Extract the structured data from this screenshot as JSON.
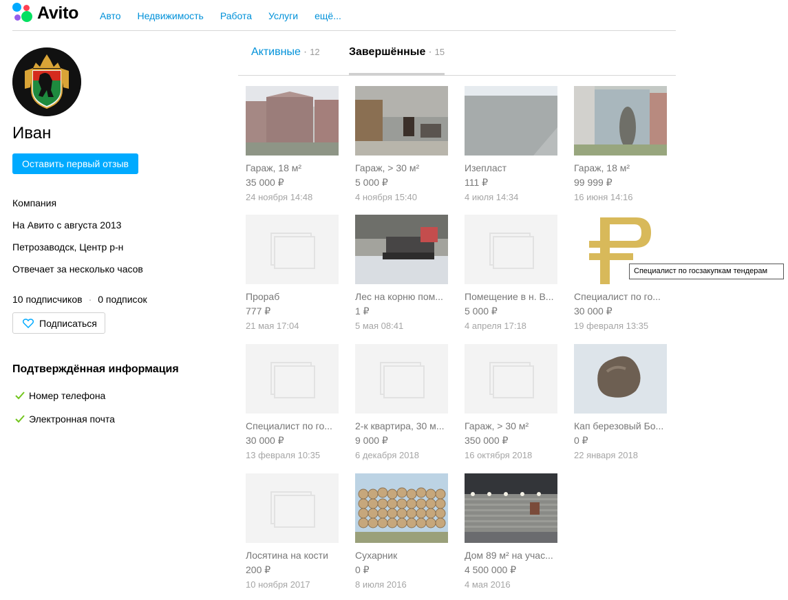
{
  "header": {
    "logo_text": "Avito",
    "nav": [
      "Авто",
      "Недвижимость",
      "Работа",
      "Услуги",
      "ещё..."
    ]
  },
  "profile": {
    "name": "Иван",
    "review_button": "Оставить первый отзыв",
    "type": "Компания",
    "since": "На Авито с августа 2013",
    "location": "Петрозаводск, Центр р-н",
    "response": "Отвечает за несколько часов",
    "subscribers": "10 подписчиков",
    "subscriptions": "0 подписок",
    "subscribe_button": "Подписаться"
  },
  "verified": {
    "title": "Подтверждённая информация",
    "items": [
      "Номер телефона",
      "Электронная почта"
    ]
  },
  "tabs": {
    "active": {
      "label": "Активные",
      "count": "12"
    },
    "done": {
      "label": "Завершённые",
      "count": "15"
    }
  },
  "items": [
    {
      "title": "Гараж, 18 м²",
      "price": "35 000 ₽",
      "date": "24 ноября 14:48",
      "image": "garage-photo"
    },
    {
      "title": "Гараж, > 30 м²",
      "price": "5 000 ₽",
      "date": "4 ноября 15:40",
      "image": "garage-interior-photo"
    },
    {
      "title": "Изепласт",
      "price": "111 ₽",
      "date": "4 июля 14:34",
      "image": "roof-photo"
    },
    {
      "title": "Гараж, 18 м²",
      "price": "99 999 ₽",
      "date": "16 июня 14:16",
      "image": "garage-door-photo"
    },
    {
      "title": "Прораб",
      "price": "777 ₽",
      "date": "21 мая 17:04",
      "image": "placeholder"
    },
    {
      "title": "Лес на корню пом...",
      "price": "1 ₽",
      "date": "5 мая 08:41",
      "image": "tractor-photo"
    },
    {
      "title": "Помещение в н. В...",
      "price": "5 000 ₽",
      "date": "4 апреля 17:18",
      "image": "placeholder"
    },
    {
      "title": "Специалист по го...",
      "price": "30 000 ₽",
      "date": "19 февраля 13:35",
      "image": "ruble-sign"
    },
    {
      "title": "Специалист по го...",
      "price": "30 000 ₽",
      "date": "13 февраля 10:35",
      "image": "placeholder"
    },
    {
      "title": "2-к квартира, 30 м...",
      "price": "9 000 ₽",
      "date": "6 декабря 2018",
      "image": "placeholder"
    },
    {
      "title": "Гараж, > 30 м²",
      "price": "350 000 ₽",
      "date": "16 октября 2018",
      "image": "placeholder"
    },
    {
      "title": "Кап березовый Бо...",
      "price": "0 ₽",
      "date": "22 января 2018",
      "image": "burl-photo"
    },
    {
      "title": "Лосятина на кости",
      "price": "200 ₽",
      "date": "10 ноября 2017",
      "image": "placeholder"
    },
    {
      "title": "Сухарник",
      "price": "0 ₽",
      "date": "8 июля 2016",
      "image": "logs-photo"
    },
    {
      "title": "Дом 89 м² на учас...",
      "price": "4 500 000 ₽",
      "date": "4 мая 2016",
      "image": "house-photo"
    }
  ],
  "tooltip": "Специалист по госзакупкам тендерам"
}
